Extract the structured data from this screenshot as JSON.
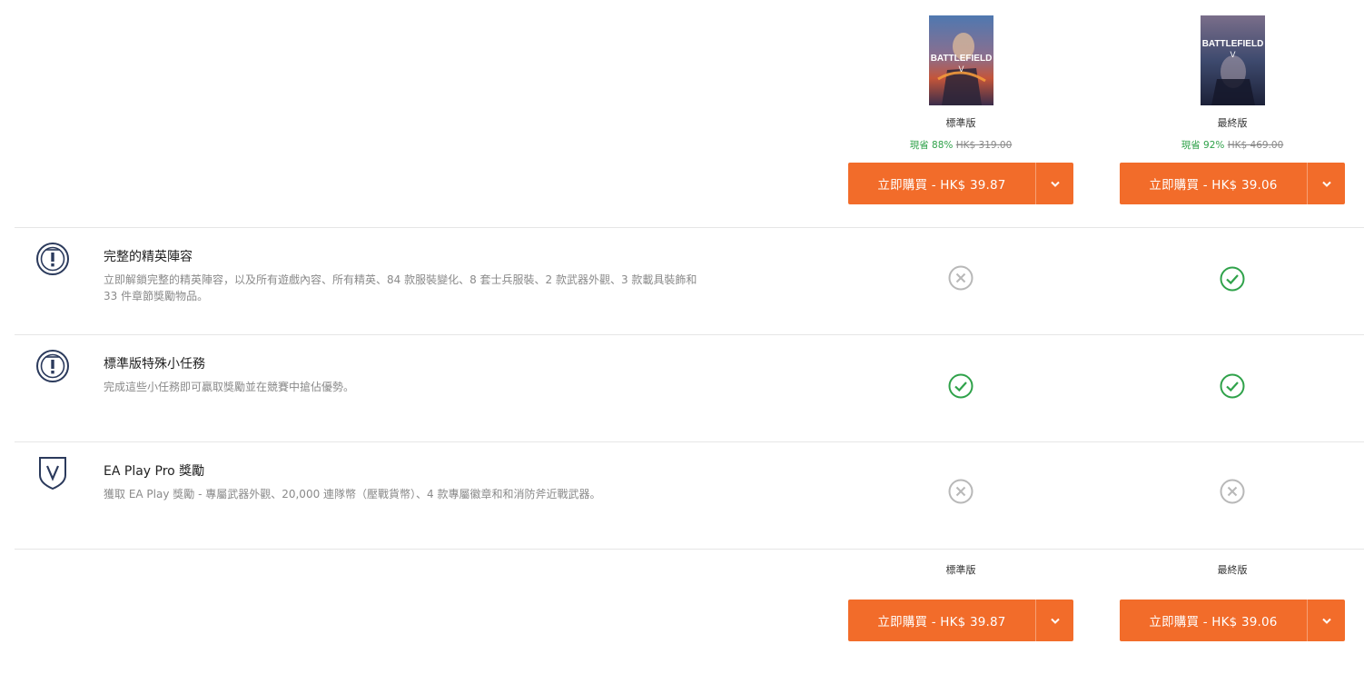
{
  "editions": {
    "standard": {
      "name": "標準版",
      "save_text": "現省 88%",
      "old_price": "HK$ 319.00",
      "buy_label": "立即購買 - HK$ 39.87"
    },
    "ultimate": {
      "name": "最終版",
      "save_text": "現省 92%",
      "old_price": "HK$ 469.00",
      "buy_label": "立即購買 - HK$ 39.06"
    }
  },
  "features": [
    {
      "title": "完整的精英陣容",
      "description_line1": "立即解鎖完整的精英陣容，以及所有遊戲內容、所有精英、84 款服裝變化、8 套士兵服裝、2 款武器外觀、3 款載具裝飾和",
      "description_line2": "33 件章節獎勵物品。",
      "icon": "elite-badge-icon",
      "standard": "not-included",
      "ultimate": "included"
    },
    {
      "title": "標準版特殊小任務",
      "description_line1": "完成這些小任務即可贏取獎勵並在競賽中搶佔優勢。",
      "icon": "mission-badge-icon",
      "standard": "included",
      "ultimate": "included"
    },
    {
      "title": "EA Play Pro 獎勵",
      "description_line1": "獲取 EA Play 獎勵 - 專屬武器外觀、20,000 連隊幣（壓戰貨幣）、4 款專屬徽章和和消防斧近戰武器。",
      "icon": "ea-play-shield-icon",
      "standard": "not-included",
      "ultimate": "not-included"
    }
  ],
  "colors": {
    "accent": "#f26c2a",
    "check": "#2fa24a",
    "cross": "#b8b8b8",
    "icon_navy": "#2b3a5c"
  }
}
